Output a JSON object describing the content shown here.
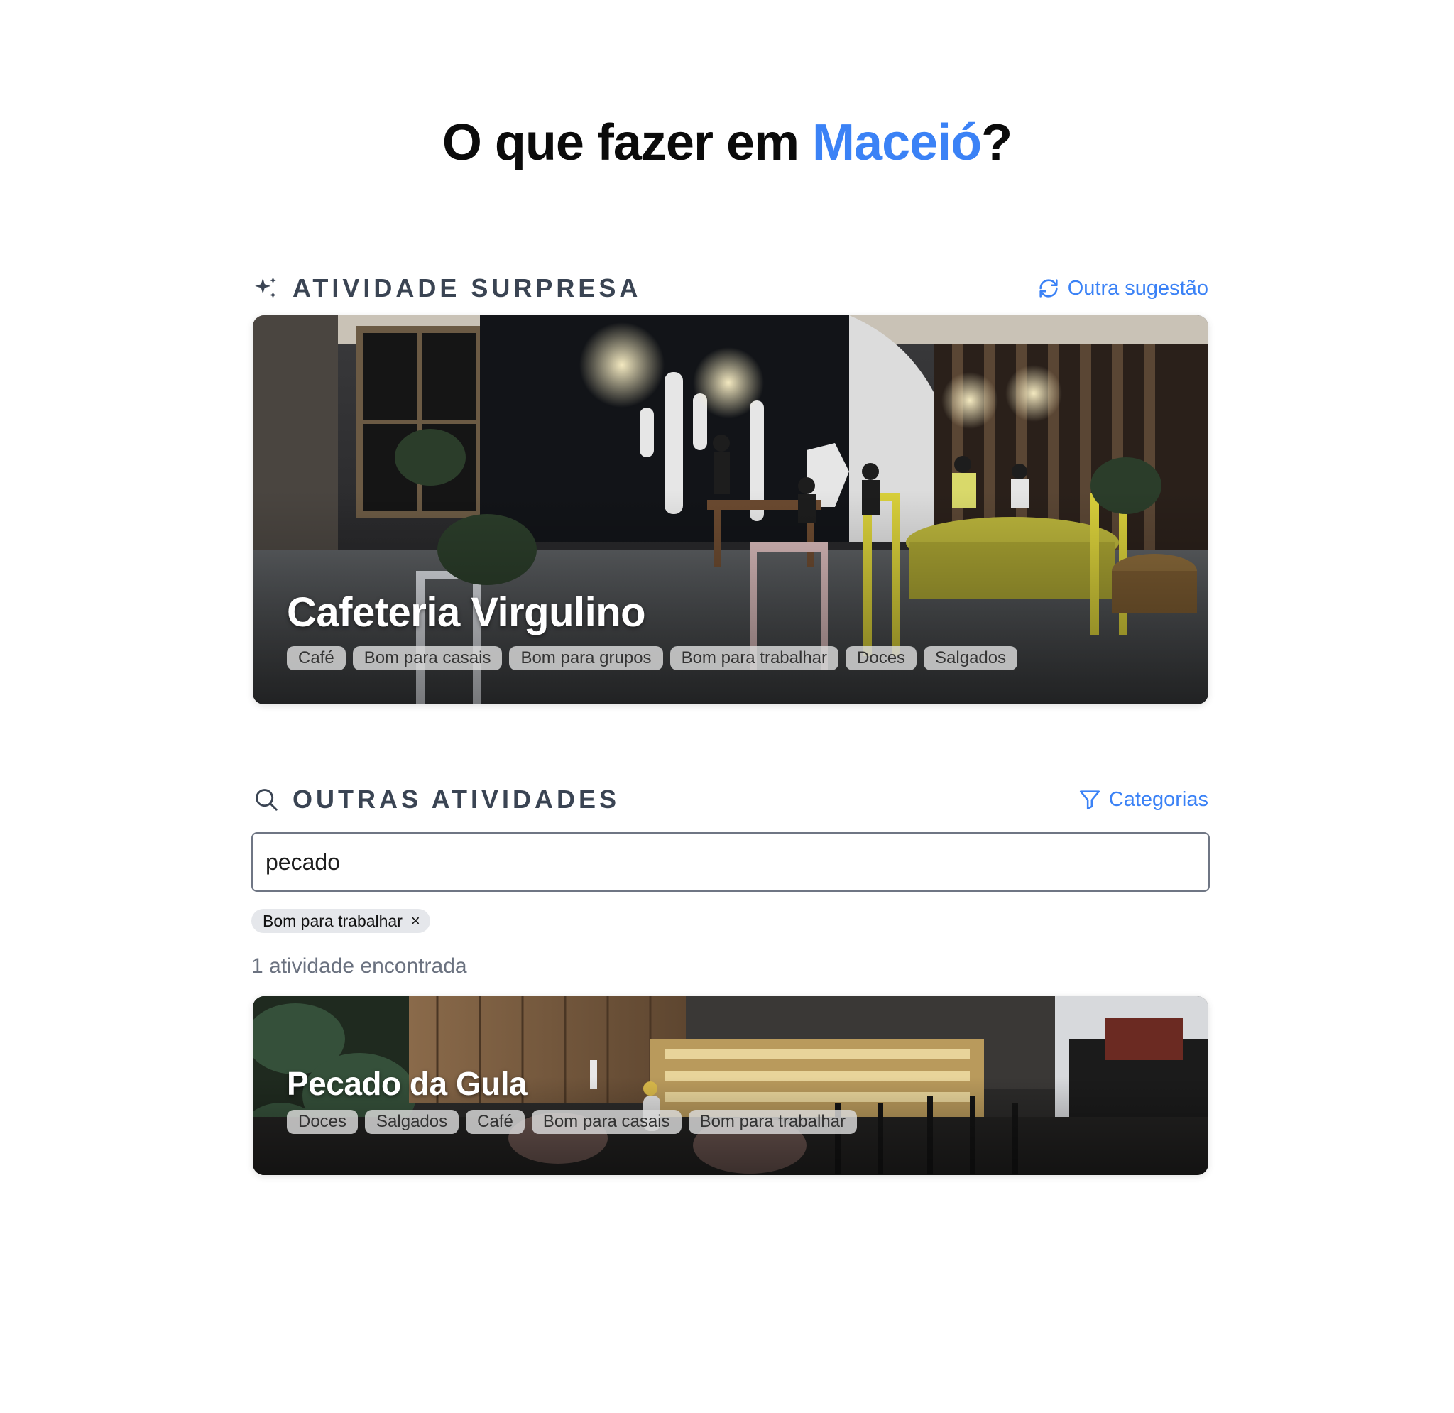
{
  "header": {
    "title_prefix": "O que fazer em ",
    "title_city": "Maceió",
    "title_suffix": "?"
  },
  "surprise": {
    "label": "ATIVIDADE SURPRESA",
    "icon": "sparkles-icon",
    "action_label": "Outra sugestão",
    "action_icon": "refresh-icon",
    "card": {
      "name": "Cafeteria Virgulino",
      "tags": [
        "Café",
        "Bom para casais",
        "Bom para grupos",
        "Bom para trabalhar",
        "Doces",
        "Salgados"
      ]
    }
  },
  "others": {
    "label": "OUTRAS ATIVIDADES",
    "icon": "search-icon",
    "action_label": "Categorias",
    "action_icon": "filter-icon",
    "search_value": "pecado",
    "active_filter": "Bom para trabalhar",
    "remove_filter_glyph": "×",
    "results_count": "1 atividade encontrada",
    "results": [
      {
        "name": "Pecado da Gula",
        "tags": [
          "Doces",
          "Salgados",
          "Café",
          "Bom para casais",
          "Bom para trabalhar"
        ]
      }
    ]
  },
  "colors": {
    "accent": "#3b82f6",
    "section_label": "#3a4453",
    "muted": "#6b7280"
  }
}
